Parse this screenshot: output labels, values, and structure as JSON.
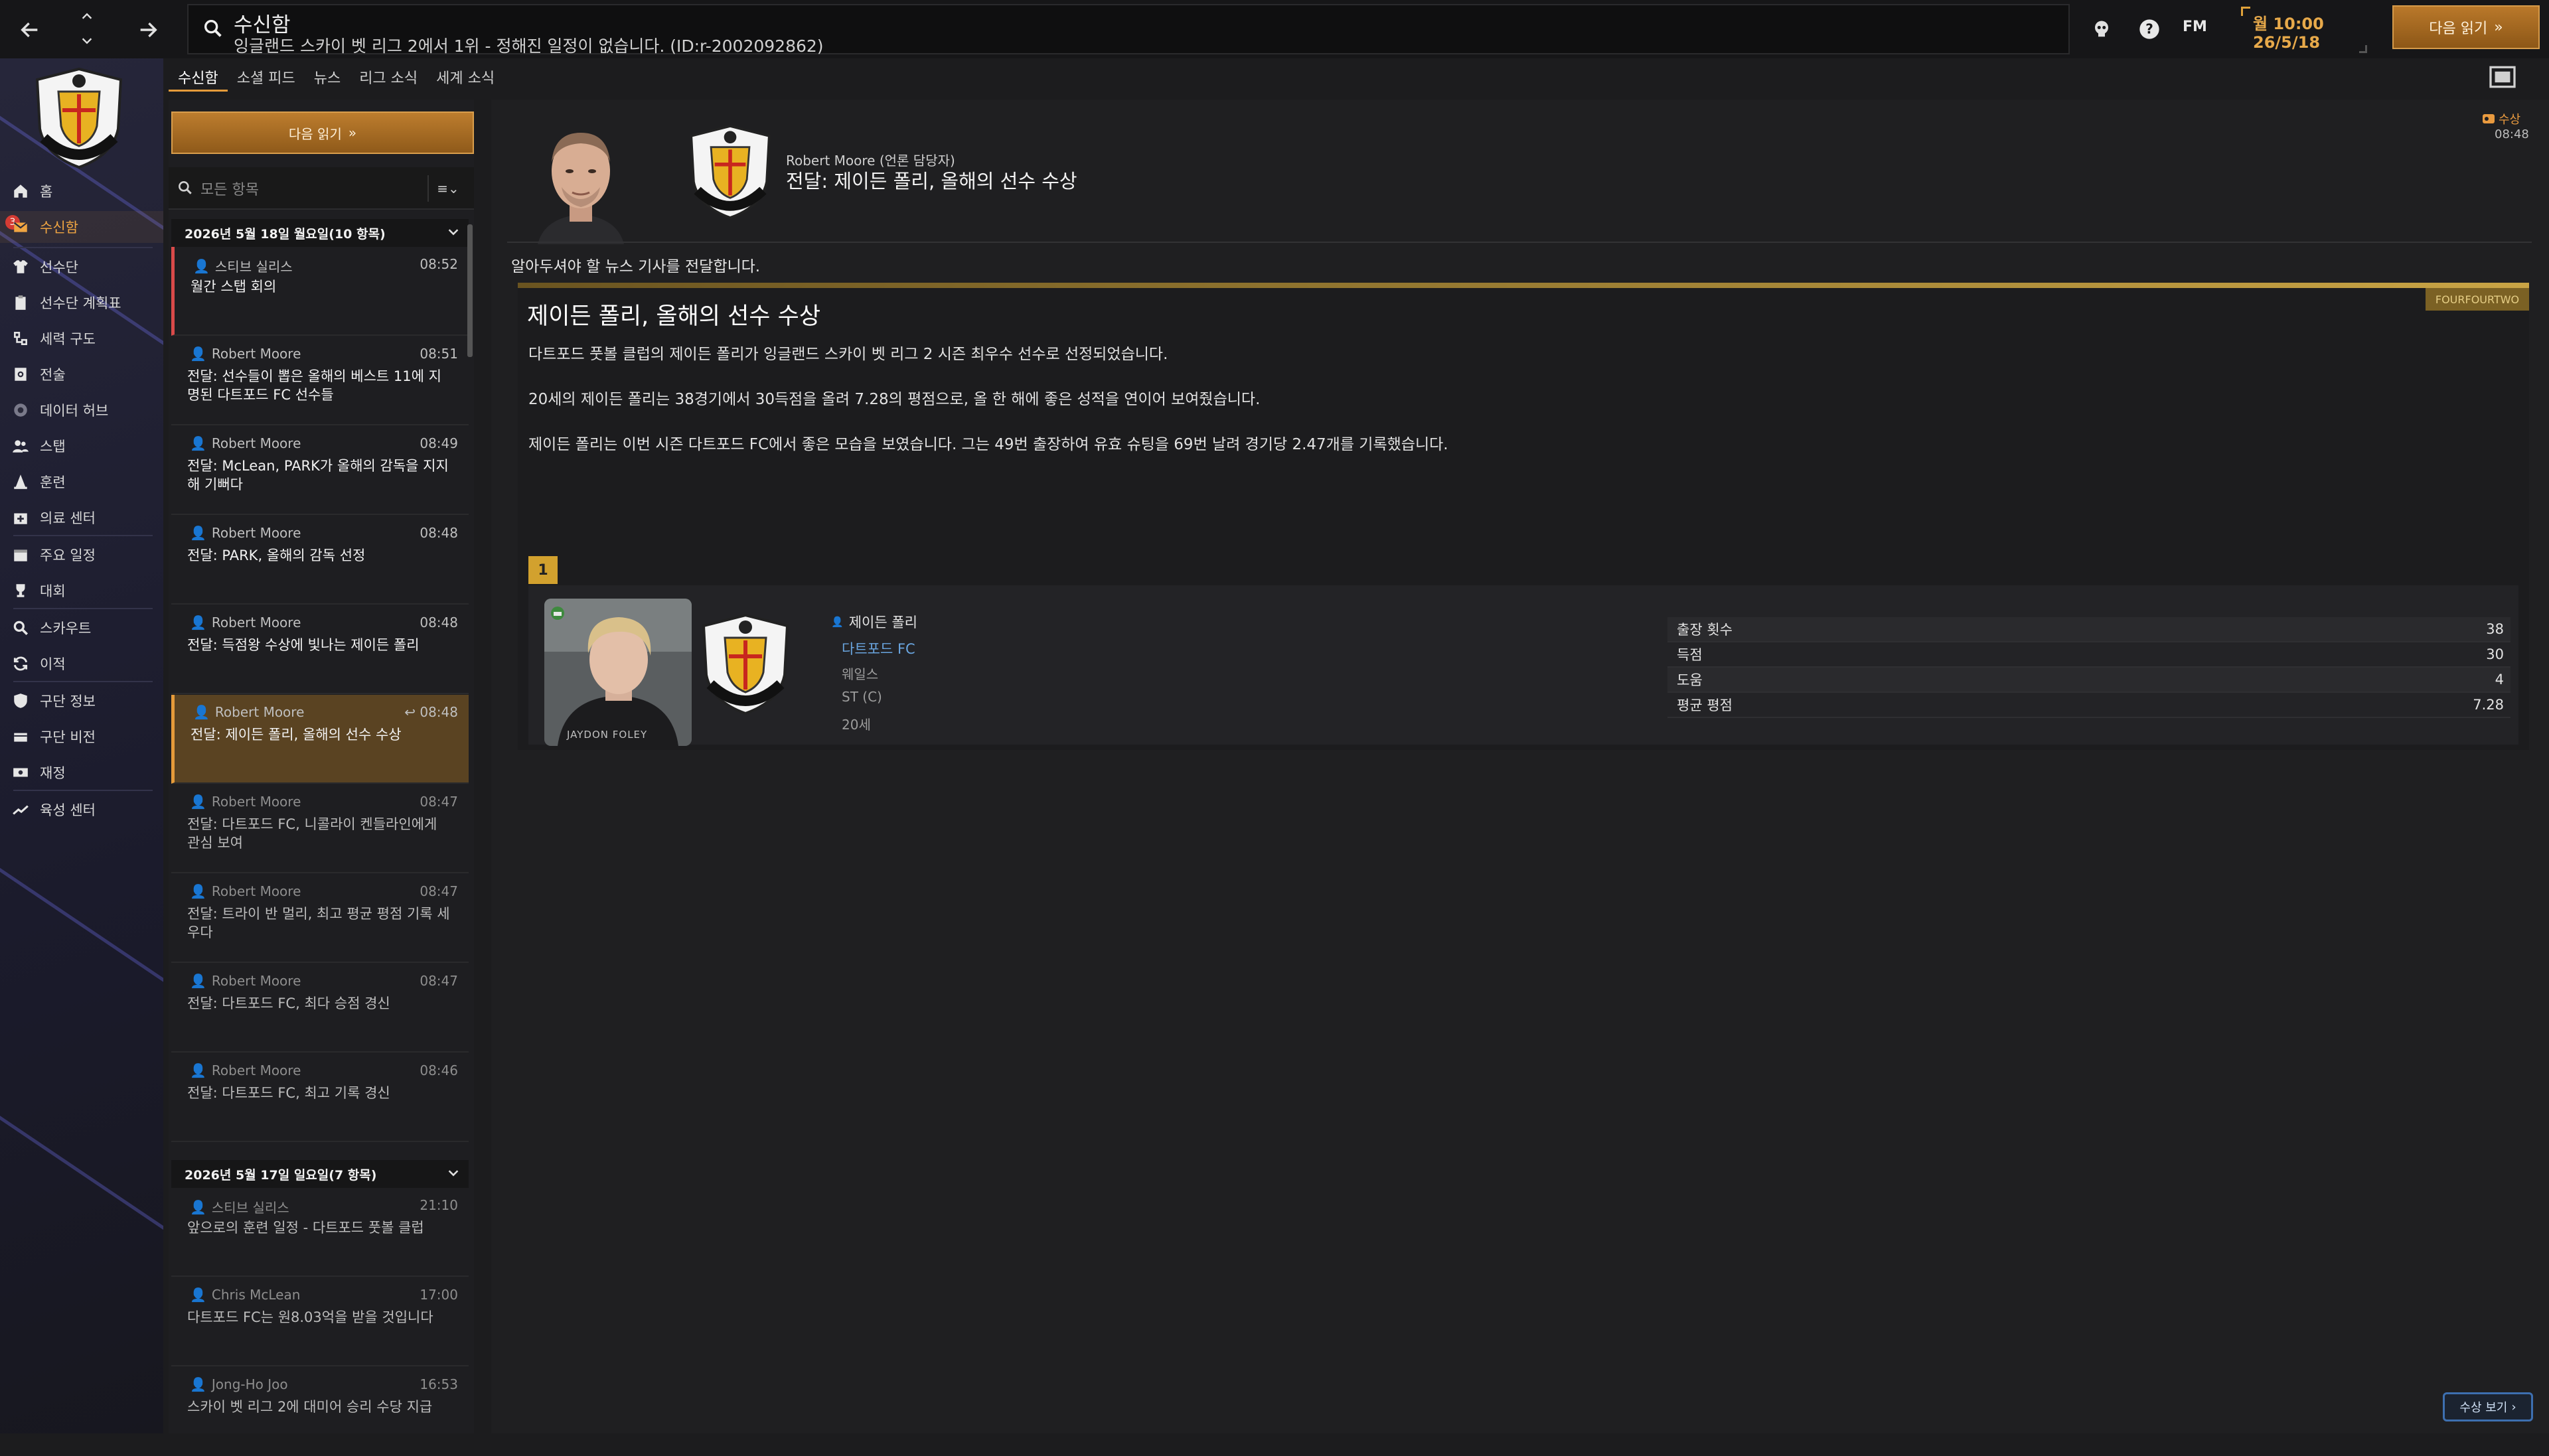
{
  "topbar": {
    "title": "수신함",
    "subtitle": "잉글랜드 스카이 벳 리그 2에서 1위 - 정해진 일정이 없습니다. (ID:r-2002092862)",
    "brand": "FM",
    "time": "월 10:00",
    "date": "26/5/18",
    "continue_label": "다음 읽기"
  },
  "sidebar": {
    "badge_count": "3",
    "items": [
      {
        "label": "홈",
        "icon": "home-icon"
      },
      {
        "label": "수신함",
        "icon": "inbox-icon"
      },
      {
        "label": "선수단",
        "icon": "shirt-icon"
      },
      {
        "label": "선수단 계획표",
        "icon": "clipboard-icon"
      },
      {
        "label": "세력 구도",
        "icon": "hierarchy-icon"
      },
      {
        "label": "전술",
        "icon": "tactics-board-icon"
      },
      {
        "label": "데이터 허브",
        "icon": "data-hub-icon"
      },
      {
        "label": "스탭",
        "icon": "staff-icon"
      },
      {
        "label": "훈련",
        "icon": "cone-icon"
      },
      {
        "label": "의료 센터",
        "icon": "medical-kit-icon"
      },
      {
        "label": "주요 일정",
        "icon": "calendar-icon"
      },
      {
        "label": "대회",
        "icon": "trophy-icon"
      },
      {
        "label": "스카우트",
        "icon": "magnifier-icon"
      },
      {
        "label": "이적",
        "icon": "transfer-icon"
      },
      {
        "label": "구단 정보",
        "icon": "shield-icon"
      },
      {
        "label": "구단 비전",
        "icon": "vision-icon"
      },
      {
        "label": "재정",
        "icon": "money-icon"
      },
      {
        "label": "육성 센터",
        "icon": "development-icon"
      }
    ]
  },
  "tabs": [
    {
      "label": "수신함",
      "active": true
    },
    {
      "label": "소셜 피드",
      "active": false
    },
    {
      "label": "뉴스",
      "active": false
    },
    {
      "label": "리그 소식",
      "active": false
    },
    {
      "label": "세계 소식",
      "active": false
    }
  ],
  "inbox": {
    "continue_label": "다음 읽기",
    "filter_placeholder": "모든 항목",
    "groups": [
      {
        "header": "2026년 5월 18일 월요일(10 항목)",
        "messages": [
          {
            "sender": "스티브 실리스",
            "time": "08:52",
            "subject": "월간 스탭 회의",
            "state": "unread"
          },
          {
            "sender": "Robert Moore",
            "time": "08:51",
            "subject": "전달: 선수들이 뽑은 올해의 베스트 11에 지명된 다트포드 FC 선수들",
            "state": "new"
          },
          {
            "sender": "Robert Moore",
            "time": "08:49",
            "subject": "전달: McLean, PARK가 올해의 감독을 지지해 기뻐다",
            "state": "new"
          },
          {
            "sender": "Robert Moore",
            "time": "08:48",
            "subject": "전달: PARK, 올해의 감독 선정",
            "state": "new"
          },
          {
            "sender": "Robert Moore",
            "time": "08:48",
            "subject": "전달: 득점왕 수상에 빛나는 제이든 폴리",
            "state": "new"
          },
          {
            "sender": "Robert Moore",
            "time": "08:48",
            "subject": "전달: 제이든 폴리, 올해의 선수 수상",
            "state": "selected"
          },
          {
            "sender": "Robert Moore",
            "time": "08:47",
            "subject": "전달: 다트포드 FC, 니콜라이 켄들라인에게 관심 보여",
            "state": "read"
          },
          {
            "sender": "Robert Moore",
            "time": "08:47",
            "subject": "전달: 트라이 반 멀리, 최고 평균 평점 기록 세우다",
            "state": "read"
          },
          {
            "sender": "Robert Moore",
            "time": "08:47",
            "subject": "전달: 다트포드 FC, 최다 승점 경신",
            "state": "read"
          },
          {
            "sender": "Robert Moore",
            "time": "08:46",
            "subject": "전달: 다트포드 FC, 최고 기록 경신",
            "state": "read"
          }
        ]
      },
      {
        "header": "2026년 5월 17일 일요일(7 항목)",
        "messages": [
          {
            "sender": "스티브 실리스",
            "time": "21:10",
            "subject": "앞으로의 훈련 일정 - 다트포드 풋볼 클럽",
            "state": "read"
          },
          {
            "sender": "Chris McLean",
            "time": "17:00",
            "subject": "다트포드 FC는 원8.03억을 받을 것입니다",
            "state": "read"
          },
          {
            "sender": "Jong-Ho Joo",
            "time": "16:53",
            "subject": "스카이 벳 리그 2에 대미어 승리 수당 지급",
            "state": "read"
          }
        ]
      }
    ]
  },
  "message": {
    "from": "Robert Moore (언론 담당자)",
    "title": "전달: 제이든 폴리, 올해의 선수 수상",
    "tag": "수상",
    "time": "08:48",
    "intro": "알아두셔야 할 뉴스 기사를 전달합니다.",
    "article": {
      "source": "FOURFOURTWO",
      "headline": "제이든 폴리, 올해의 선수 수상",
      "paragraphs": [
        "다트포드 풋볼 클럽의 제이든 폴리가 잉글랜드 스카이 벳 리그 2 시즌 최우수 선수로 선정되었습니다.",
        "20세의 제이든 폴리는 38경기에서 30득점을 올려 7.28의 평점으로, 올 한 해에 좋은 성적을 연이어 보여줬습니다.",
        "제이든 폴리는 이번 시즌 다트포드 FC에서 좋은 모습을 보였습니다. 그는 49번 출장하여 유효 슈팅을 69번 날려 경기당 2.47개를 기록했습니다."
      ],
      "rank": "1",
      "player": {
        "name": "제이든 폴리",
        "club": "다트포드 FC",
        "nation": "웨일스",
        "position": "ST (C)",
        "age": "20세",
        "photo_caption": "JAYDON FOLEY"
      },
      "stats": [
        {
          "label": "출장 횟수",
          "value": "38"
        },
        {
          "label": "득점",
          "value": "30"
        },
        {
          "label": "도움",
          "value": "4"
        },
        {
          "label": "평균 평점",
          "value": "7.28"
        }
      ]
    },
    "award_button": "수상 보기"
  },
  "colors": {
    "accent": "#e59b3a",
    "unread": "#d94a4a",
    "link": "#6aa6e0",
    "gold": "#d2a12e"
  }
}
